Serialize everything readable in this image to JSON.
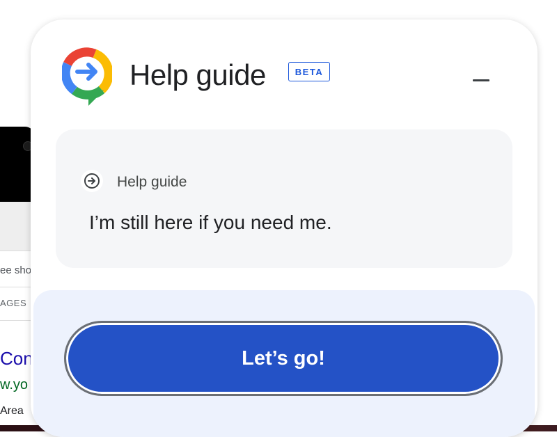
{
  "background_page": {
    "snippet_text": "ee sho",
    "tab_text": "AGES",
    "result_link": "Con",
    "result_url": "w.yo",
    "result_snippet": "Area"
  },
  "panel": {
    "title": "Help guide",
    "badge": "BETA",
    "logo_icon": "google-help-guide-logo-icon",
    "minimize_icon": "minimize-icon"
  },
  "message_card": {
    "sender": "Help guide",
    "sender_icon": "arrow-circle-icon",
    "message": "I’m still here if you need me."
  },
  "footer": {
    "cta_label": "Let’s go!"
  },
  "colors": {
    "accent": "#2452c6",
    "badge": "#1a56db",
    "card_bg": "#f5f6f8",
    "footer_bg": "#edf2fd"
  }
}
